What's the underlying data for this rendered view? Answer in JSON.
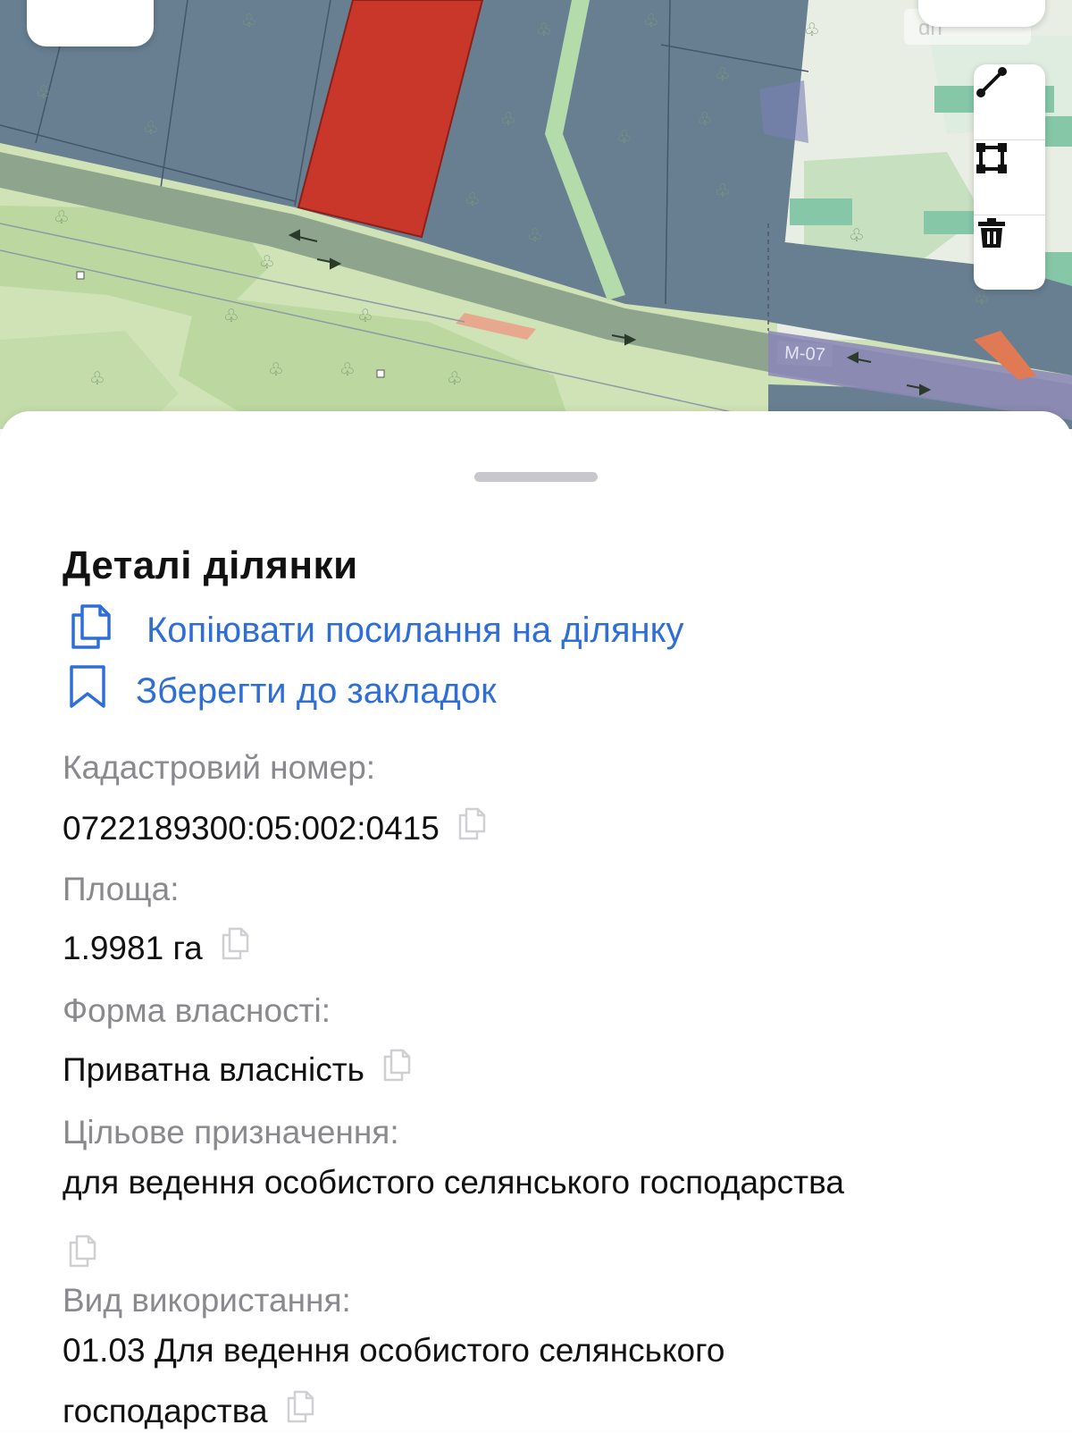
{
  "map": {
    "road_label": "M-07",
    "watermark": "dn",
    "buttons": {
      "layers_icon": "layers-icon",
      "bookmark_icon": "bookmark-icon",
      "tools": [
        "ruler-icon",
        "polygon-icon",
        "trash-icon"
      ]
    },
    "colors": {
      "parcel": "#677f91",
      "selected_parcel": "#c8372a",
      "forest": "#cfe3b6",
      "road": "#8fa48c"
    }
  },
  "sheet": {
    "title": "Деталі ділянки",
    "actions": {
      "copy_link": "Копіювати посилання на ділянку",
      "save_bookmark": "Зберегти до закладок"
    },
    "fields": {
      "cadastral_label": "Кадастровий номер:",
      "cadastral_value": "0722189300:05:002:0415",
      "area_label": "Площа:",
      "area_value": "1.9981 га",
      "ownership_label": "Форма власності:",
      "ownership_value": "Приватна власність",
      "purpose_label": "Цільове призначення:",
      "purpose_value": "для ведення особистого селянського господарства",
      "usage_label": "Вид використання:",
      "usage_value_line1": "01.03 Для ведення особистого селянського",
      "usage_value_line2": "господарства"
    },
    "accent_color": "#2f6ed6"
  }
}
